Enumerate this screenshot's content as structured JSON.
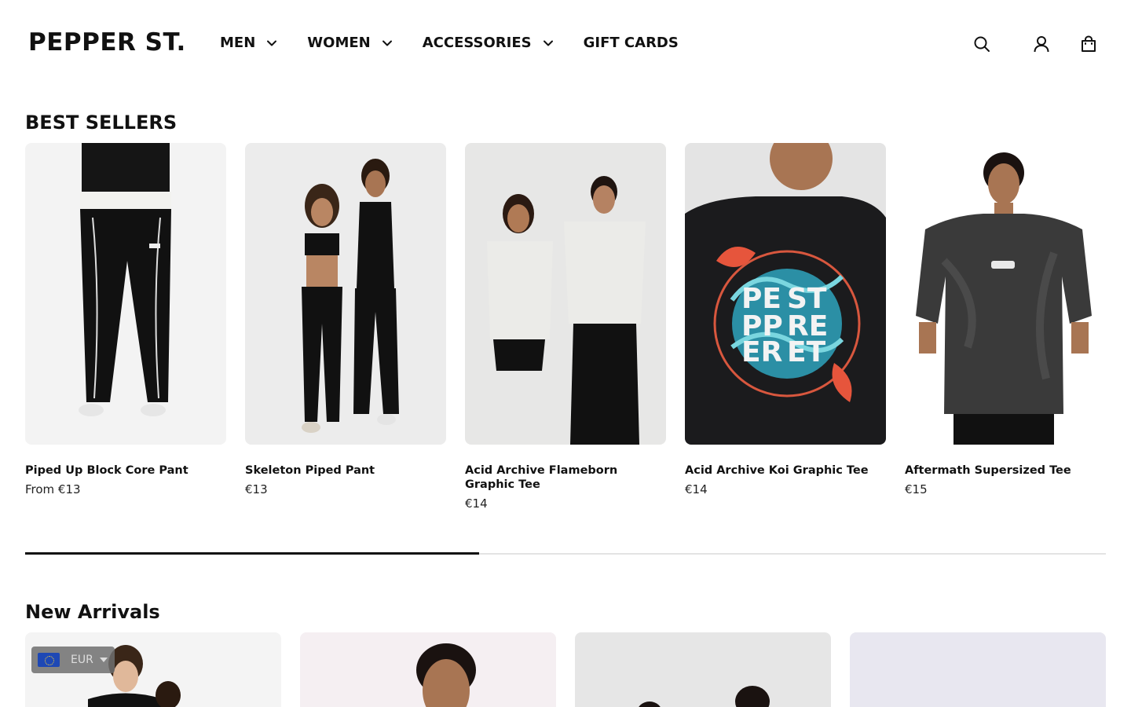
{
  "header": {
    "logo": "PEPPER ST.",
    "nav": [
      {
        "label": "MEN",
        "has_dropdown": true
      },
      {
        "label": "WOMEN",
        "has_dropdown": true
      },
      {
        "label": "ACCESSORIES",
        "has_dropdown": true
      },
      {
        "label": "GIFT CARDS",
        "has_dropdown": false
      }
    ],
    "icons": [
      "search-icon",
      "account-icon",
      "cart-icon"
    ]
  },
  "best_sellers": {
    "title": "BEST SELLERS",
    "products": [
      {
        "name": "Piped Up Block Core Pant",
        "price": "From €13"
      },
      {
        "name": "Skeleton Piped Pant",
        "price": "€13"
      },
      {
        "name": "Acid Archive Flameborn Graphic Tee",
        "price": "€14"
      },
      {
        "name": "Acid Archive Koi Graphic Tee",
        "price": "€14"
      },
      {
        "name": "Aftermath Supersized Tee",
        "price": "€15"
      }
    ],
    "carousel_progress": 0.42
  },
  "new_arrivals": {
    "title": "New Arrivals"
  },
  "currency": {
    "code": "EUR",
    "flag": "eu-flag-icon"
  },
  "colors": {
    "text": "#111111",
    "background": "#ffffff",
    "image_bg": "#f2f2f2"
  }
}
